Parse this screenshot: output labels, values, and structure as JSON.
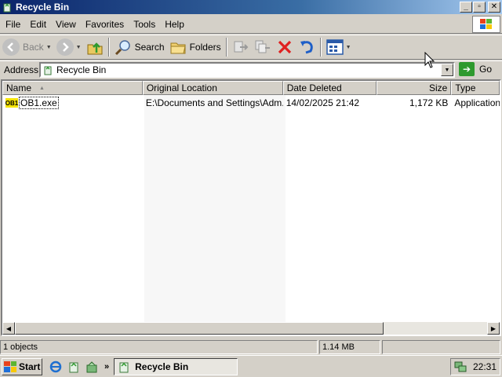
{
  "window": {
    "title": "Recycle Bin",
    "controls": {
      "minimize": "_",
      "maximize": "▫",
      "close": "✕"
    }
  },
  "menubar": {
    "items": [
      {
        "label": "File"
      },
      {
        "label": "Edit"
      },
      {
        "label": "View"
      },
      {
        "label": "Favorites"
      },
      {
        "label": "Tools"
      },
      {
        "label": "Help"
      }
    ]
  },
  "toolbar": {
    "back_label": "Back",
    "search_label": "Search",
    "folders_label": "Folders"
  },
  "address": {
    "label": "Address",
    "value": "Recycle Bin",
    "go_label": "Go"
  },
  "list": {
    "columns": [
      "Name",
      "Original Location",
      "Date Deleted",
      "Size",
      "Type"
    ],
    "rows": [
      {
        "icon_text": "OB1",
        "name": "OB1.exe",
        "location": "E:\\Documents and Settings\\Adm...",
        "date": "14/02/2025 21:42",
        "size": "1,172 KB",
        "type": "Application"
      }
    ]
  },
  "status": {
    "objects": "1 objects",
    "size": "1.14 MB"
  },
  "taskbar": {
    "start_label": "Start",
    "chevron": "»",
    "task_label": "Recycle Bin",
    "clock": "22:31"
  },
  "colors": {
    "title_start": "#0a246a",
    "title_end": "#a6caf0",
    "face": "#d4d0c8",
    "go_green": "#2e9a2e",
    "delete_red": "#e02020",
    "undo_blue": "#1e5fc8",
    "file_yellow": "#f5e400"
  }
}
